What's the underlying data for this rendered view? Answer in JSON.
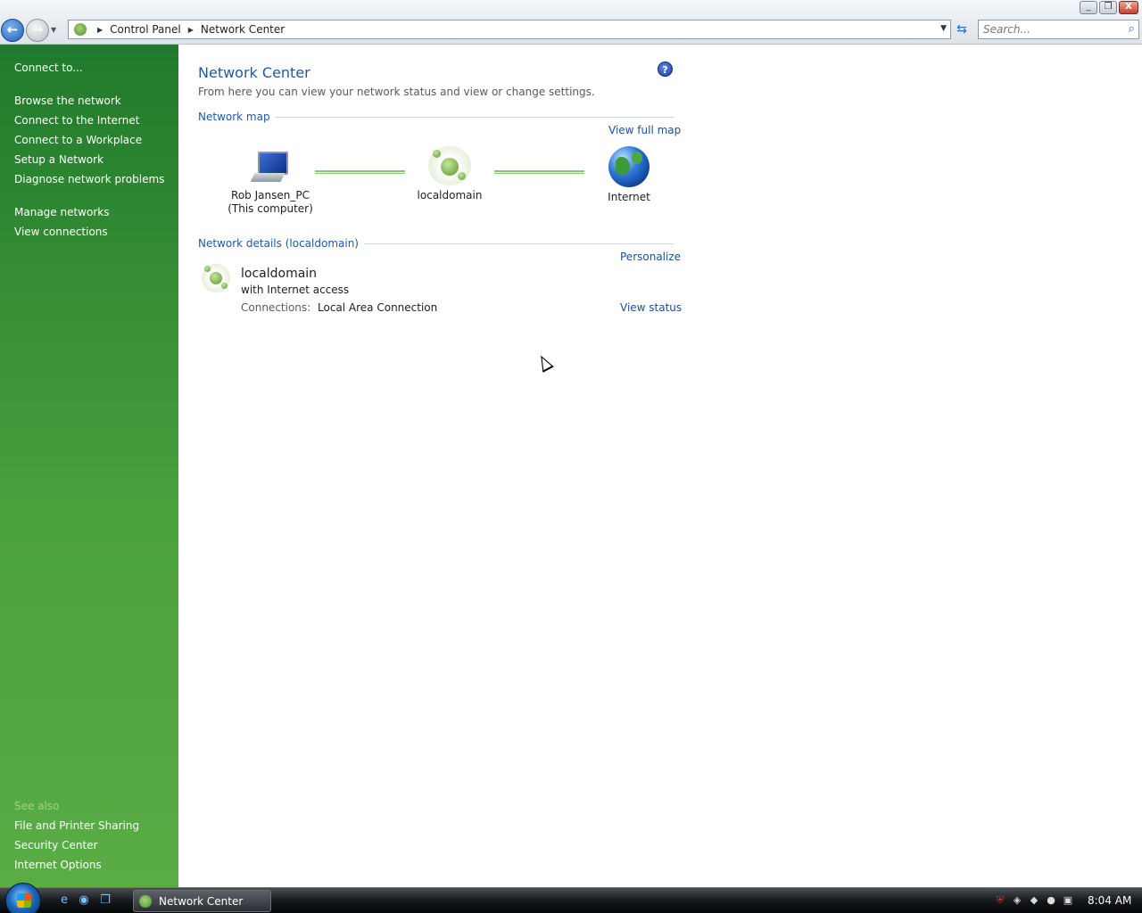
{
  "window": {
    "minimize_label": "_",
    "maximize_label": "❐",
    "close_label": "X"
  },
  "toolbar": {
    "back_glyph": "←",
    "forward_glyph": "→",
    "breadcrumbs": [
      "Control Panel",
      "Network Center"
    ],
    "search_placeholder": "Search..."
  },
  "sidebar": {
    "tasks_group1": [
      "Connect to..."
    ],
    "tasks_group2": [
      "Browse the network",
      "Connect to the Internet",
      "Connect to a Workplace",
      "Setup a Network",
      "Diagnose network problems"
    ],
    "tasks_group3": [
      "Manage networks",
      "View connections"
    ],
    "see_also_label": "See also",
    "see_also": [
      "File and Printer Sharing",
      "Security Center",
      "Internet Options"
    ]
  },
  "main": {
    "title": "Network Center",
    "help_glyph": "?",
    "description": "From here you can view your network status and view or change settings.",
    "map": {
      "heading": "Network map",
      "view_full_map": "View full map",
      "nodes": [
        {
          "line1": "Rob Jansen_PC",
          "line2": "(This computer)"
        },
        {
          "line1": "localdomain",
          "line2": ""
        },
        {
          "line1": "Internet",
          "line2": ""
        }
      ]
    },
    "details": {
      "heading": "Network details (localdomain)",
      "personalize": "Personalize",
      "network_name": "localdomain",
      "access": "with Internet access",
      "connections_label": "Connections:",
      "connections_value": "Local Area Connection",
      "view_status": "View status"
    }
  },
  "taskbar": {
    "active_window": "Network Center",
    "clock": "8:04 AM"
  },
  "colors": {
    "sidebar_green": "#3e9437",
    "link_blue": "#1e4fa0",
    "heading_blue": "#1e5aa8"
  }
}
